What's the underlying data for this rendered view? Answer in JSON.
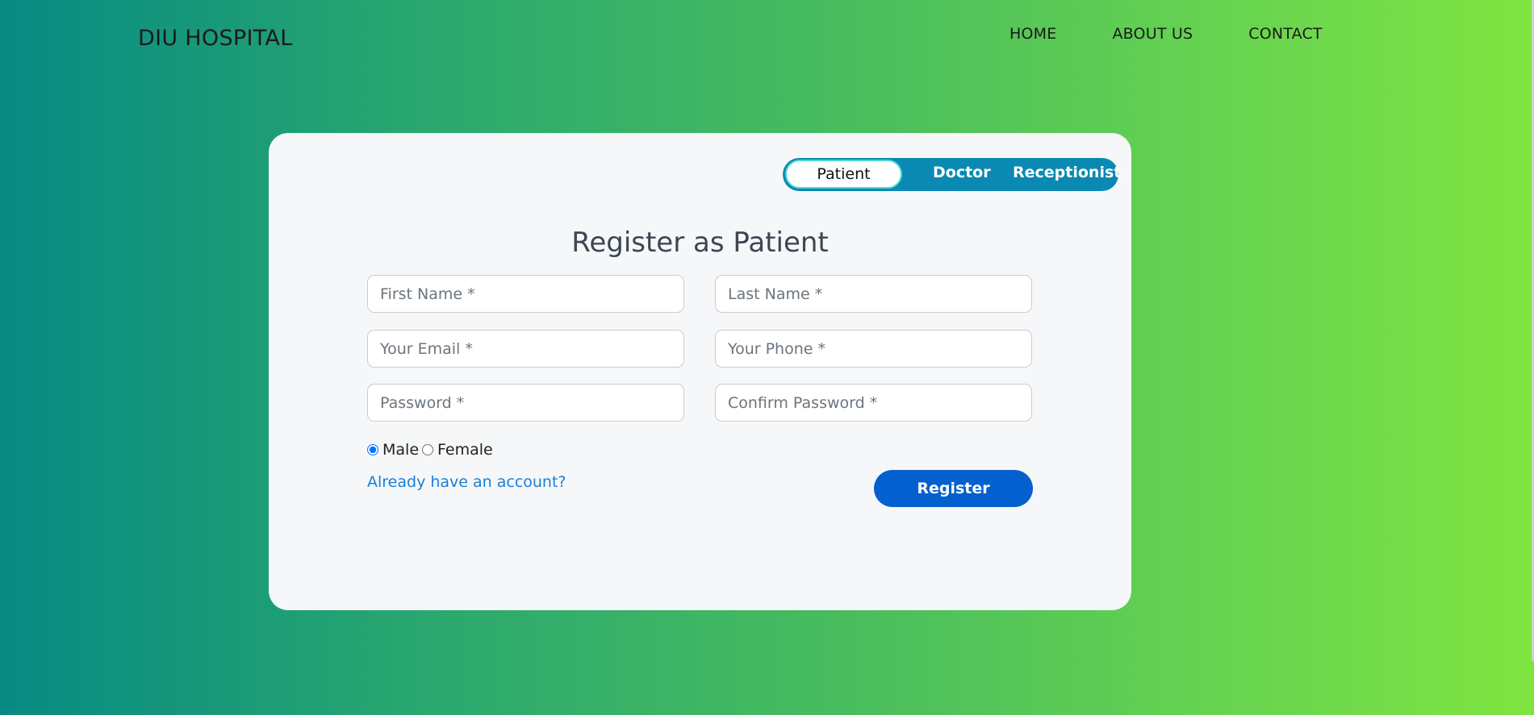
{
  "navbar": {
    "brand": "DIU HOSPITAL",
    "links": [
      "HOME",
      "ABOUT US",
      "CONTACT"
    ]
  },
  "role_toggle": {
    "options": [
      "Patient",
      "Doctor",
      "Receptionist"
    ],
    "selected": "Patient"
  },
  "form": {
    "title": "Register as Patient",
    "first_name": {
      "placeholder": "First Name *",
      "value": ""
    },
    "last_name": {
      "placeholder": "Last Name *",
      "value": ""
    },
    "email": {
      "placeholder": "Your Email *",
      "value": ""
    },
    "phone": {
      "placeholder": "Your Phone *",
      "value": ""
    },
    "password": {
      "placeholder": "Password *",
      "value": ""
    },
    "confirm_password": {
      "placeholder": "Confirm Password *",
      "value": ""
    },
    "gender": {
      "options": [
        "Male",
        "Female"
      ],
      "selected": "Male"
    },
    "login_link": "Already have an account?",
    "submit_label": "Register"
  },
  "colors": {
    "gradient_start": "#078a83",
    "gradient_end": "#7fe440",
    "toggle_bg": "#0a89b2",
    "button_bg": "#0360ce",
    "link": "#1a7fd6"
  }
}
